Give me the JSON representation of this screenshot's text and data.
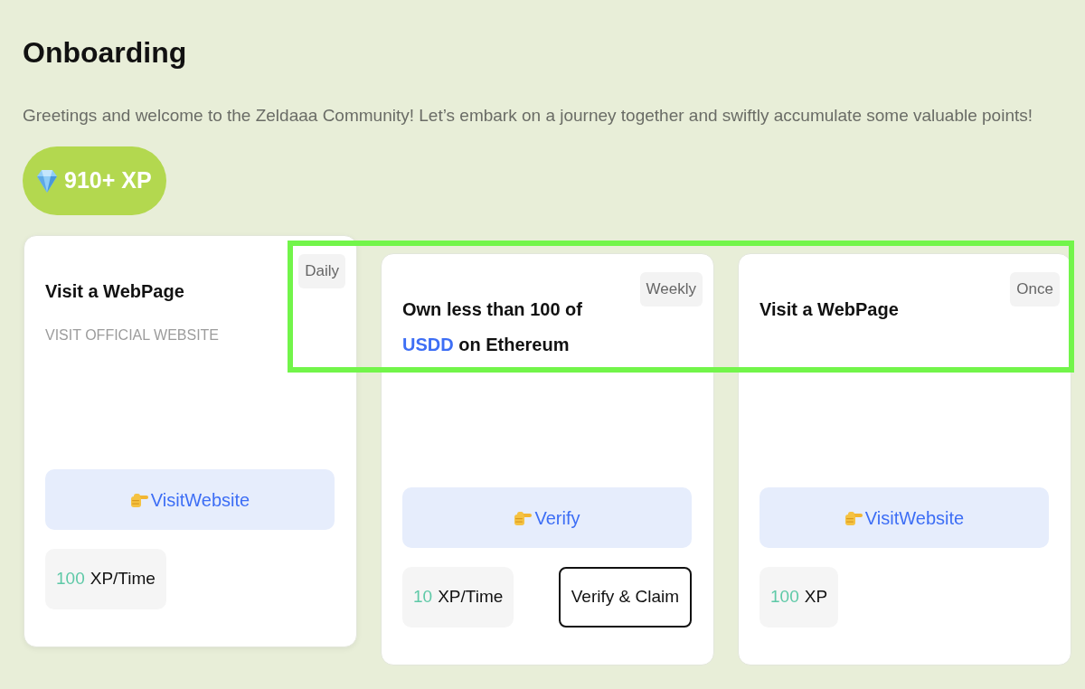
{
  "page": {
    "title": "Onboarding",
    "description": "Greetings and welcome to the Zeldaaa Community! Let’s embark on a journey together and swiftly accumulate some valuable points!",
    "xp_total": "910+ XP"
  },
  "tasks": [
    {
      "frequency": "Daily",
      "hovered": true,
      "title": [
        {
          "kind": "plain",
          "text": "Visit a WebPage"
        }
      ],
      "subtitle": "VISIT OFFICIAL WEBSITE",
      "action": "VisitWebsite",
      "reward_amount": "100",
      "reward_unit": "XP/Time"
    },
    {
      "frequency": "Weekly",
      "hovered": false,
      "title": [
        {
          "kind": "plain",
          "text": "Own less than 100 of "
        },
        {
          "kind": "link",
          "text": "USDD"
        },
        {
          "kind": "plain",
          "text": " on Ethereum"
        }
      ],
      "action": "Verify",
      "reward_amount": "10",
      "reward_unit": "XP/Time",
      "claim_button": "Verify & Claim"
    },
    {
      "frequency": "Once",
      "hovered": false,
      "title": [
        {
          "kind": "plain",
          "text": "Visit a WebPage"
        }
      ],
      "action": "VisitWebsite",
      "reward_amount": "100",
      "reward_unit": "XP"
    }
  ]
}
